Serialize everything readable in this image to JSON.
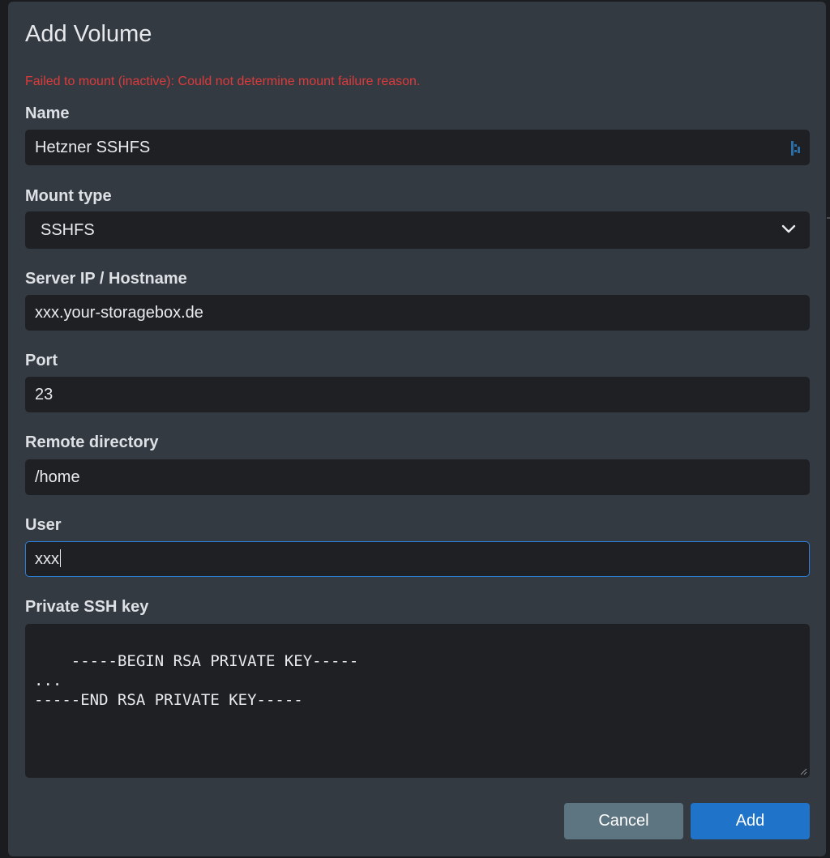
{
  "dialog": {
    "title": "Add Volume",
    "error": "Failed to mount (inactive): Could not determine mount failure reason."
  },
  "fields": {
    "name": {
      "label": "Name",
      "value": "Hetzner SSHFS"
    },
    "mount_type": {
      "label": "Mount type",
      "value": "SSHFS"
    },
    "server": {
      "label": "Server IP / Hostname",
      "value": "xxx.your-storagebox.de"
    },
    "port": {
      "label": "Port",
      "value": "23"
    },
    "remote_dir": {
      "label": "Remote directory",
      "value": "/home"
    },
    "user": {
      "label": "User",
      "value": "xxx"
    },
    "ssh_key": {
      "label": "Private SSH key",
      "value": "-----BEGIN RSA PRIVATE KEY-----\n...\n-----END RSA PRIVATE KEY-----"
    }
  },
  "buttons": {
    "cancel": "Cancel",
    "add": "Add"
  },
  "colors": {
    "dialog_bg": "#343a42",
    "input_bg": "#1e2024",
    "error": "#dc3b3b",
    "focus_border": "#2c7fd6",
    "cancel_bg": "#5d7481",
    "add_bg": "#1f73c9"
  },
  "icons": {
    "name_field": "password-manager-icon",
    "mount_select": "chevron-down-icon"
  }
}
